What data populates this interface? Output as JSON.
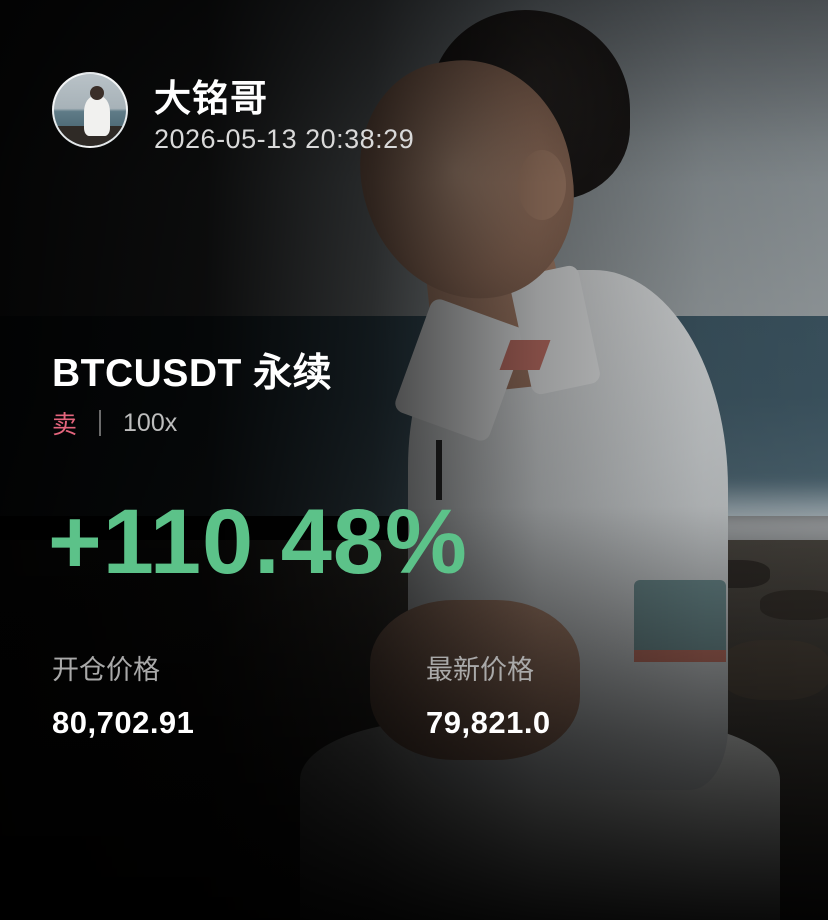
{
  "user": {
    "name": "大铭哥",
    "timestamp": "2026-05-13 20:38:29"
  },
  "position": {
    "pair": "BTCUSDT 永续",
    "side": "卖",
    "leverage": "100x",
    "pnl_percent": "+110.48%"
  },
  "prices": {
    "open_label": "开仓价格",
    "open_value": "80,702.91",
    "last_label": "最新价格",
    "last_value": "79,821.0"
  },
  "colors": {
    "profit_green": "#5cc289",
    "sell_red": "#e4657d",
    "background": "#050505"
  },
  "icons": {
    "avatar": "user-avatar-photo"
  }
}
